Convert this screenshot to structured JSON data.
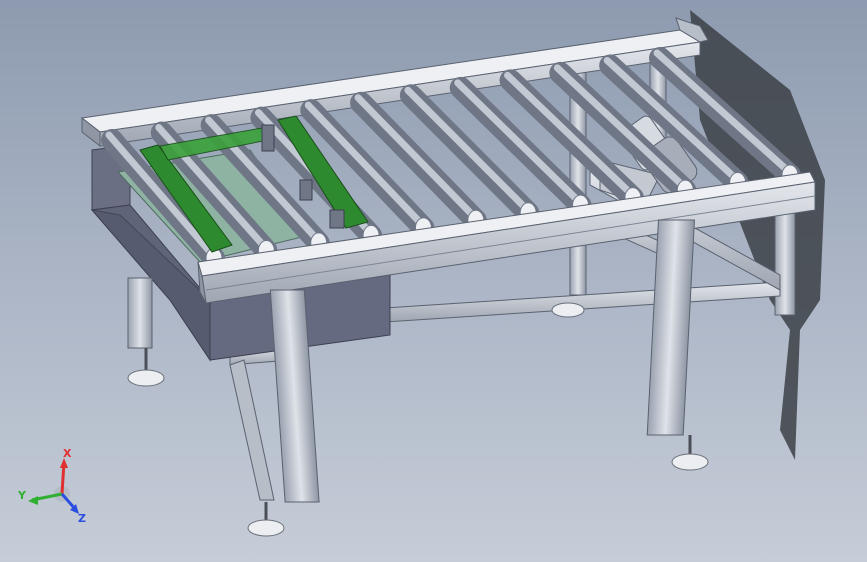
{
  "viewport": {
    "background_top": "#8d9aaf",
    "background_bottom": "#c6cdd8"
  },
  "model": {
    "frame_color": "#c9ced6",
    "roller_color": "#9aa3b3",
    "belt_color": "#2e8a2e",
    "panel_color": "#5f6478",
    "tray_color": "#8fb3a3"
  },
  "triad": {
    "x_label": "X",
    "y_label": "Y",
    "z_label": "Z",
    "x_color": "#e03030",
    "y_color": "#30b030",
    "z_color": "#2a4fe0"
  }
}
